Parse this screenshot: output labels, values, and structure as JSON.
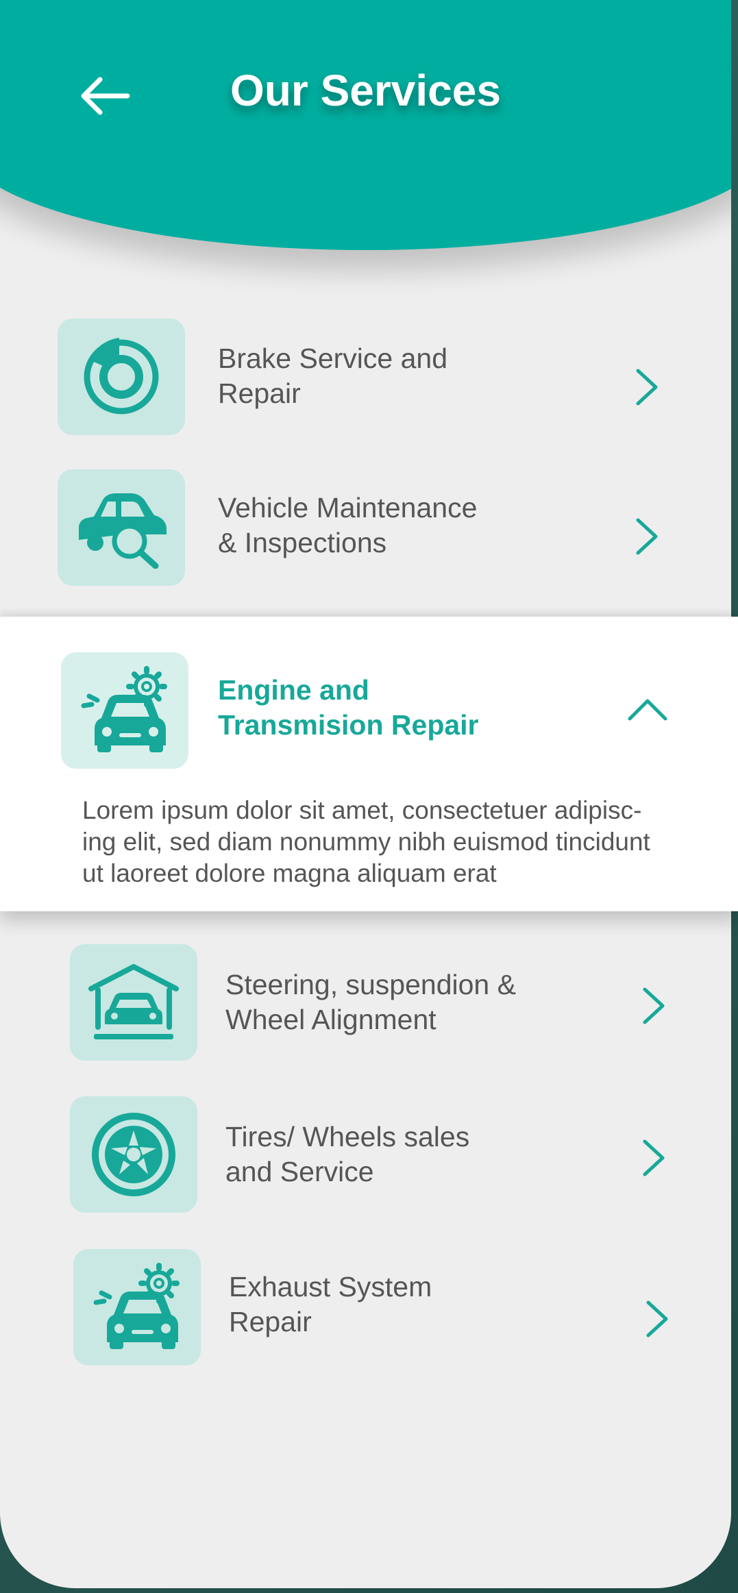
{
  "header": {
    "title": "Our Services",
    "back_icon": "arrow-left-icon"
  },
  "colors": {
    "accent": "#00ae9f",
    "icon_bg": "#c9e8e3",
    "text": "#555555"
  },
  "services": [
    {
      "label": "Brake Service and Repair",
      "line1": "Brake Service and",
      "line2": "Repair",
      "icon": "brake-disc-icon",
      "state": "collapsed"
    },
    {
      "label": "Vehicle Maintenance & Inspections",
      "line1": "Vehicle Maintenance",
      "line2": "& Inspections",
      "icon": "car-inspection-icon",
      "state": "collapsed"
    },
    {
      "label": "Engine and Transmision Repair",
      "line1": "Engine and",
      "line2": "Transmision Repair",
      "icon": "car-gear-icon",
      "state": "expanded",
      "description_lines": [
        "Lorem ipsum dolor sit amet, consectetuer adipisc-",
        "ing elit, sed diam nonummy nibh euismod tincidunt",
        "ut laoreet dolore magna aliquam erat"
      ]
    },
    {
      "label": "Steering, suspendion & Wheel Alignment",
      "line1": "Steering, suspendion &",
      "line2": "Wheel Alignment",
      "icon": "garage-car-icon",
      "state": "collapsed"
    },
    {
      "label": "Tires/ Wheels sales and Service",
      "line1": "Tires/ Wheels sales",
      "line2": "and Service",
      "icon": "wheel-icon",
      "state": "collapsed"
    },
    {
      "label": "Exhaust System Repair",
      "line1": "Exhaust System",
      "line2": "Repair",
      "icon": "car-gear-icon",
      "state": "collapsed"
    }
  ]
}
